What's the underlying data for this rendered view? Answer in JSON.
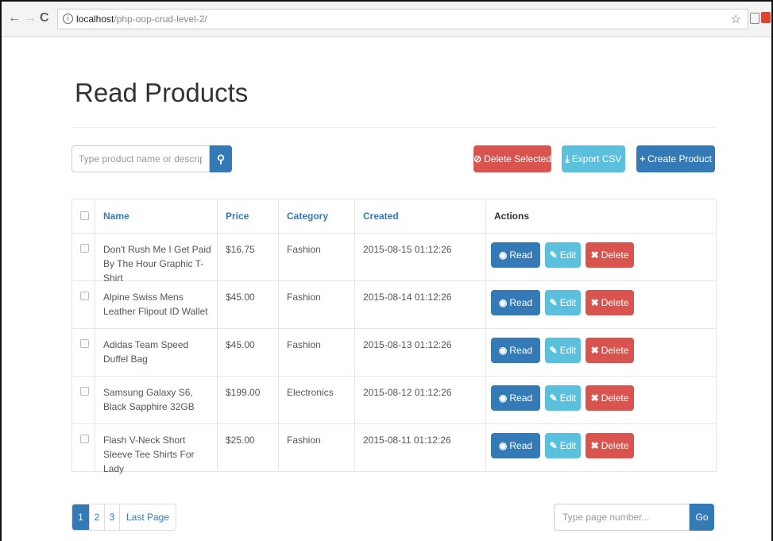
{
  "browser": {
    "url_host": "localhost",
    "url_path": "/php-oop-crud-level-2/"
  },
  "page": {
    "title": "Read Products"
  },
  "toolbar": {
    "search_placeholder": "Type product name or description...",
    "delete_selected_label": "Delete Selected",
    "export_label": "Export CSV",
    "create_label": "Create Product"
  },
  "table": {
    "headers": [
      "Name",
      "Price",
      "Category",
      "Created",
      "Actions"
    ],
    "rows": [
      {
        "name": "Don't Rush Me I Get Paid By The Hour Graphic T-Shirt",
        "price": "$16.75",
        "category": "Fashion",
        "created": "2015-08-15 01:12:26"
      },
      {
        "name": "Alpine Swiss Mens Leather Flipout ID Wallet",
        "price": "$45.00",
        "category": "Fashion",
        "created": "2015-08-14 01:12:26"
      },
      {
        "name": "Adidas Team Speed Duffel Bag",
        "price": "$45.00",
        "category": "Fashion",
        "created": "2015-08-13 01:12:26"
      },
      {
        "name": "Samsung Galaxy S6, Black Sapphire 32GB",
        "price": "$199.00",
        "category": "Electronics",
        "created": "2015-08-12 01:12:26"
      },
      {
        "name": "Flash V-Neck Short Sleeve Tee Shirts For Lady",
        "price": "$25.00",
        "category": "Fashion",
        "created": "2015-08-11 01:12:26"
      }
    ],
    "action_labels": {
      "read": "Read",
      "edit": "Edit",
      "delete": "Delete"
    }
  },
  "pagination": {
    "pages": [
      "1",
      "2",
      "3",
      "Last Page"
    ],
    "current": "1",
    "goto_placeholder": "Type page number...",
    "go_label": "Go"
  },
  "colors": {
    "primary": "#337ab7",
    "info": "#5bc0de",
    "danger": "#d9534f"
  }
}
